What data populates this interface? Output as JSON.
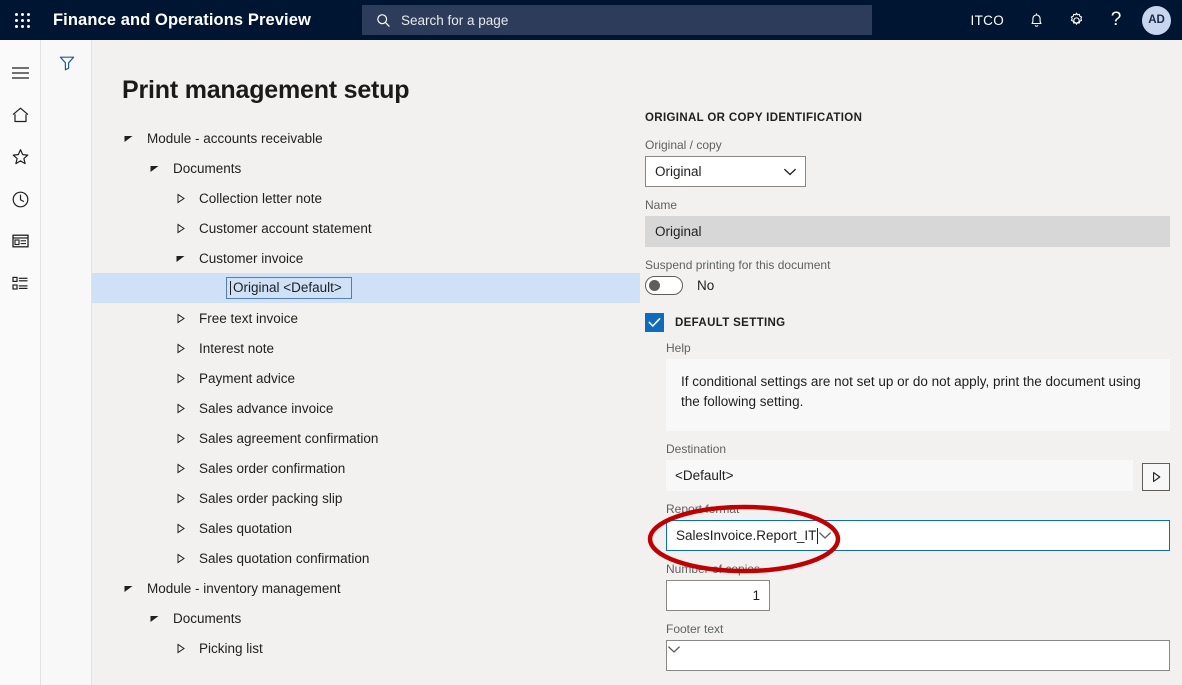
{
  "header": {
    "waffle_icon": "app-launcher-icon",
    "title": "Finance and Operations Preview",
    "search": {
      "icon": "search-icon",
      "placeholder": "Search for a page"
    },
    "company": "ITCO",
    "notifications_icon": "bell-icon",
    "settings_icon": "gear-icon",
    "help_icon": "question-mark-icon",
    "avatar_initials": "AD"
  },
  "navrail": {
    "items": [
      {
        "icon": "hamburger-menu-icon",
        "name": "menu"
      },
      {
        "icon": "home-icon",
        "name": "home"
      },
      {
        "icon": "star-icon",
        "name": "favorites"
      },
      {
        "icon": "clock-icon",
        "name": "recent"
      },
      {
        "icon": "workspace-icon",
        "name": "workspaces"
      },
      {
        "icon": "modules-list-icon",
        "name": "modules"
      }
    ]
  },
  "actionpane": {
    "filter_icon": "filter-funnel-icon"
  },
  "page": {
    "title": "Print management setup"
  },
  "tree": {
    "nodes": [
      {
        "label": "Module - accounts receivable",
        "indent": 0,
        "state": "expanded"
      },
      {
        "label": "Documents",
        "indent": 1,
        "state": "expanded"
      },
      {
        "label": "Collection letter note",
        "indent": 2,
        "state": "collapsed"
      },
      {
        "label": "Customer account statement",
        "indent": 2,
        "state": "collapsed"
      },
      {
        "label": "Customer invoice",
        "indent": 2,
        "state": "expanded"
      },
      {
        "label": "Original <Default>",
        "indent": 3,
        "state": "leaf",
        "selected": true
      },
      {
        "label": "Free text invoice",
        "indent": 2,
        "state": "collapsed"
      },
      {
        "label": "Interest note",
        "indent": 2,
        "state": "collapsed"
      },
      {
        "label": "Payment advice",
        "indent": 2,
        "state": "collapsed"
      },
      {
        "label": "Sales advance invoice",
        "indent": 2,
        "state": "collapsed"
      },
      {
        "label": "Sales agreement confirmation",
        "indent": 2,
        "state": "collapsed"
      },
      {
        "label": "Sales order confirmation",
        "indent": 2,
        "state": "collapsed"
      },
      {
        "label": "Sales order packing slip",
        "indent": 2,
        "state": "collapsed"
      },
      {
        "label": "Sales quotation",
        "indent": 2,
        "state": "collapsed"
      },
      {
        "label": "Sales quotation confirmation",
        "indent": 2,
        "state": "collapsed"
      },
      {
        "label": "Module - inventory management",
        "indent": 0,
        "state": "expanded"
      },
      {
        "label": "Documents",
        "indent": 1,
        "state": "expanded"
      },
      {
        "label": "Picking list",
        "indent": 2,
        "state": "collapsed"
      }
    ]
  },
  "details": {
    "section_title": "ORIGINAL OR COPY IDENTIFICATION",
    "original_copy": {
      "label": "Original / copy",
      "value": "Original"
    },
    "name": {
      "label": "Name",
      "value": "Original"
    },
    "suspend": {
      "label": "Suspend printing for this document",
      "value": "No"
    },
    "default_setting": {
      "title": "DEFAULT SETTING",
      "checked": true,
      "help": {
        "label": "Help",
        "text": "If conditional settings are not set up or do not apply, print the document using the following setting."
      },
      "destination": {
        "label": "Destination",
        "value": "<Default>",
        "button_icon": "play-triangle-icon"
      },
      "report_format": {
        "label": "Report format",
        "value": "SalesInvoice.Report_IT",
        "focused": true
      },
      "number_of_copies": {
        "label": "Number of copies",
        "value": "1"
      },
      "footer_text": {
        "label": "Footer text",
        "value": ""
      }
    }
  },
  "annotation": {
    "type": "ellipse-highlight",
    "color": "#c00000",
    "target": "report-format-field"
  }
}
